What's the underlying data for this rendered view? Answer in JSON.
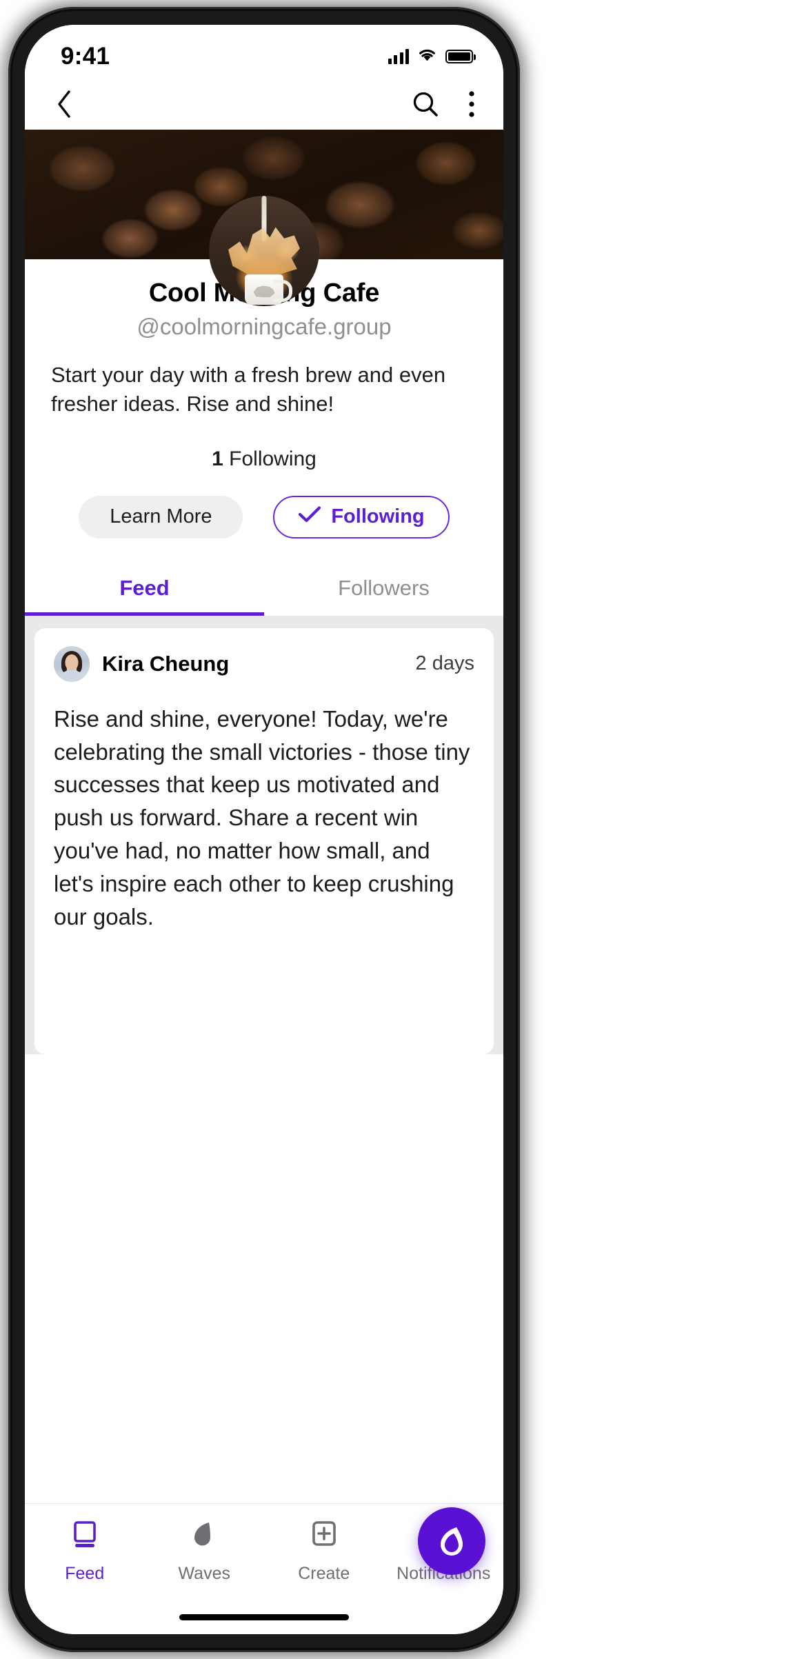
{
  "status_bar": {
    "time": "9:41",
    "icons": [
      "cellular-signal-icon",
      "wifi-icon",
      "battery-icon"
    ]
  },
  "nav_bar": {
    "back_icon": "chevron-left-icon",
    "search_icon": "search-icon",
    "overflow_icon": "more-vertical-icon"
  },
  "profile": {
    "cover_image": "coffee-beans-photo",
    "avatar_image": "coffee-splash-mug-photo",
    "name": "Cool Morning Cafe",
    "handle": "@coolmorningcafe.group",
    "bio": "Start your day with a fresh brew and even fresher ideas. Rise and shine!",
    "following_count": "1",
    "following_label": "Following"
  },
  "actions": {
    "learn_more_label": "Learn More",
    "following_label": "Following",
    "following_icon": "check-icon"
  },
  "tabs": [
    {
      "label": "Feed",
      "active": true
    },
    {
      "label": "Followers",
      "active": false
    }
  ],
  "post": {
    "avatar": "user-avatar-photo",
    "author": "Kira Cheung",
    "timestamp": "2 days",
    "body": "Rise and shine, everyone! Today, we're celebrating the small victories - those tiny successes that keep us motivated and push us forward. Share a recent win you've had, no matter how small, and let's inspire each other to keep crushing our goals."
  },
  "bottom_nav": {
    "items": [
      {
        "label": "Feed",
        "icon": "feed-icon",
        "active": true
      },
      {
        "label": "Waves",
        "icon": "waves-icon",
        "active": false
      },
      {
        "label": "Create",
        "icon": "create-plus-icon",
        "active": false
      },
      {
        "label": "Notifications",
        "icon": "bell-icon",
        "active": false
      }
    ],
    "fab_icon": "app-logo-icon"
  },
  "colors": {
    "accent": "#5b1fd0",
    "fab": "#5b11d4",
    "muted": "#8e8e93",
    "feed_bg": "#e9e9e9"
  }
}
